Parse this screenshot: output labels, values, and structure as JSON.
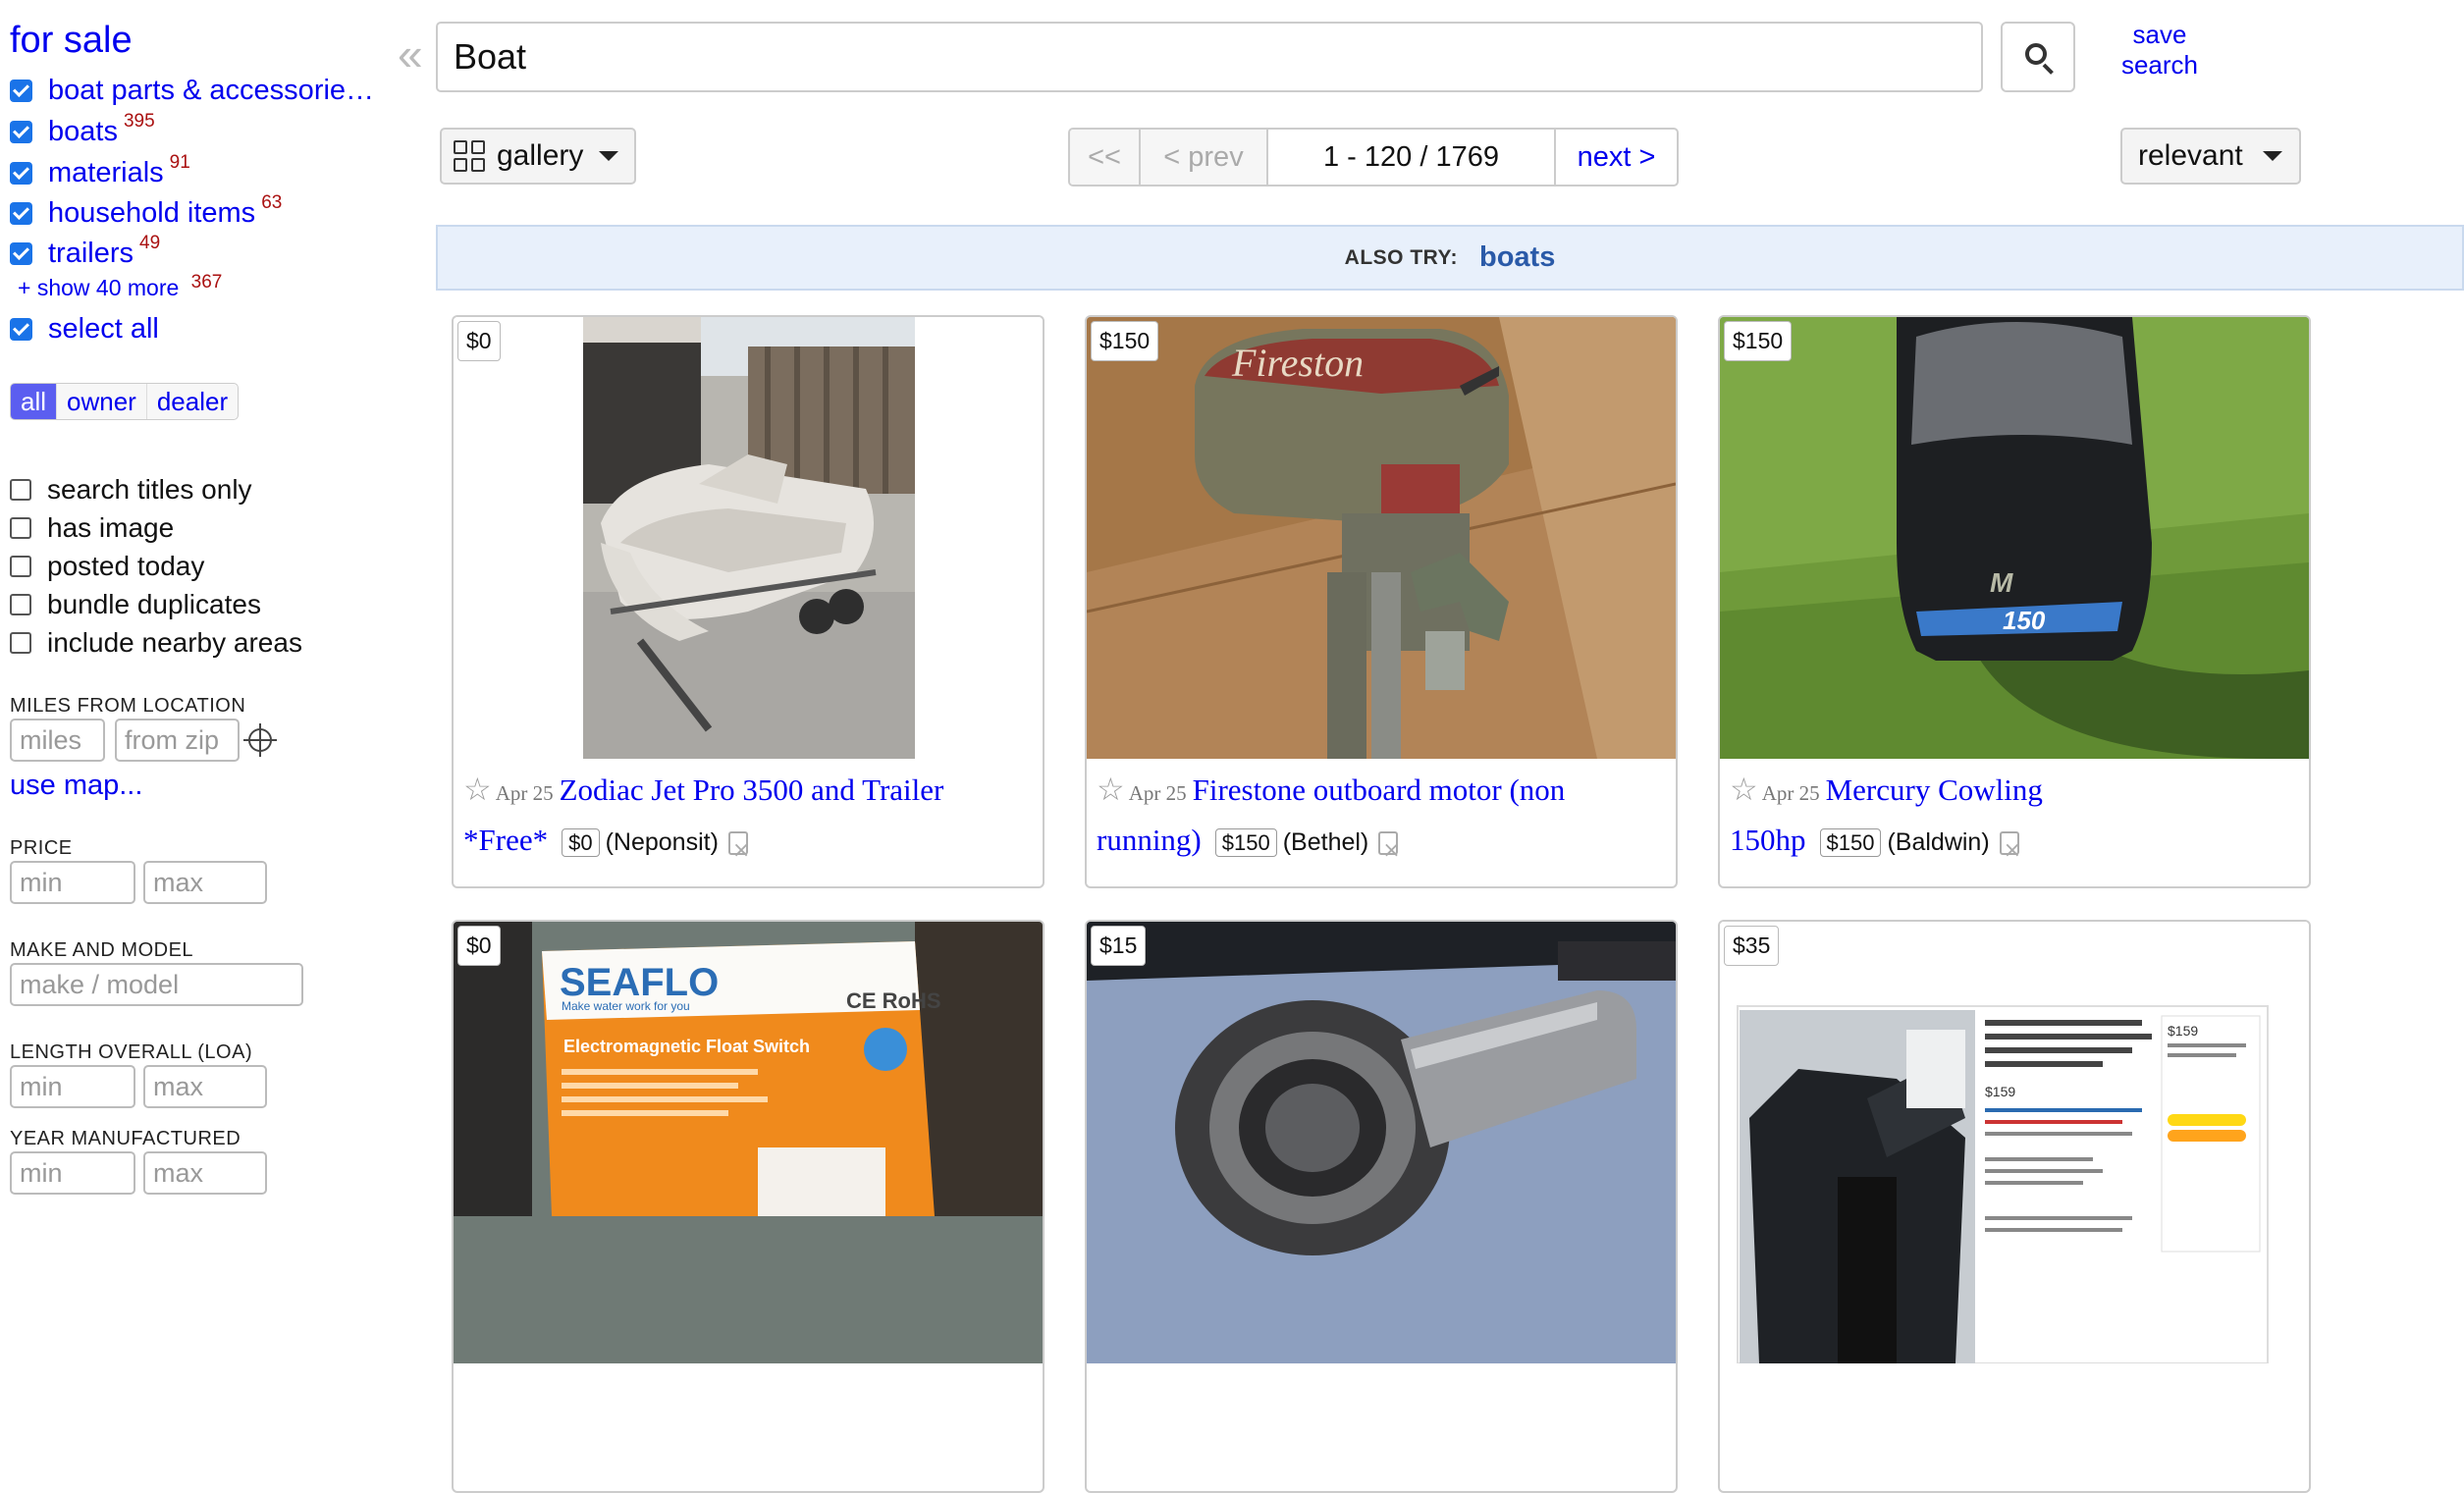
{
  "sidebar": {
    "heading": "for sale",
    "categories": [
      {
        "label": "boat parts & accessorie…",
        "count": "",
        "checked": true
      },
      {
        "label": "boats",
        "count": "395",
        "checked": true
      },
      {
        "label": "materials",
        "count": "91",
        "checked": true
      },
      {
        "label": "household items",
        "count": "63",
        "checked": true
      },
      {
        "label": "trailers",
        "count": "49",
        "checked": true
      }
    ],
    "show_more": {
      "label": "+ show 40 more",
      "count": "367"
    },
    "select_all": "select all",
    "seller_types": [
      "all",
      "owner",
      "dealer"
    ],
    "active_seller_type": "all",
    "options": [
      "search titles only",
      "has image",
      "posted today",
      "bundle duplicates",
      "include nearby areas"
    ],
    "miles_label": "MILES FROM LOCATION",
    "miles_placeholder": "miles",
    "zip_placeholder": "from zip",
    "use_map": "use map...",
    "price_label": "PRICE",
    "make_label": "MAKE AND MODEL",
    "make_placeholder": "make / model",
    "length_label": "LENGTH OVERALL (LOA)",
    "year_label": "YEAR MANUFACTURED",
    "min_placeholder": "min",
    "max_placeholder": "max"
  },
  "search": {
    "collapse_icon": "«",
    "value": "Boat",
    "save_label_1": "save",
    "save_label_2": "search"
  },
  "toolbar": {
    "view_label": "gallery",
    "pager": {
      "first": "<<",
      "prev": "< prev",
      "range": "1 - 120 / 1769",
      "next": "next >"
    },
    "sort_label": "relevant"
  },
  "also_try": {
    "label": "ALSO TRY:",
    "link": "boats"
  },
  "listings": [
    {
      "price": "$0",
      "date": "Apr 25",
      "title": "Zodiac Jet Pro 3500 and Trailer *Free*",
      "price_box": "$0",
      "location": "(Neponsit)"
    },
    {
      "price": "$150",
      "date": "Apr 25",
      "title": "Firestone outboard motor (non running)",
      "price_box": "$150",
      "location": "(Bethel)"
    },
    {
      "price": "$150",
      "date": "Apr 25",
      "title": "Mercury Cowling 150hp",
      "price_box": "$150",
      "location": "(Baldwin)"
    },
    {
      "price": "$0"
    },
    {
      "price": "$15"
    },
    {
      "price": "$35"
    }
  ],
  "photo_text": {
    "firestone": "Fireston",
    "mercury_model": "150",
    "mercury_logo": "M",
    "seaflo_brand": "SEAFLO",
    "seaflo_tagline": "Make water work for you",
    "seaflo_ce": "CE RoHS",
    "seaflo_product": "Electromagnetic Float Switch",
    "amazon_price_1": "$159",
    "amazon_price_2": "$159"
  },
  "colors": {
    "link": "#0000ee",
    "accent": "#5b5ef0",
    "checkbox": "#1a73e8",
    "count": "#aa1111",
    "also_try_bg": "#e8f0fb"
  }
}
